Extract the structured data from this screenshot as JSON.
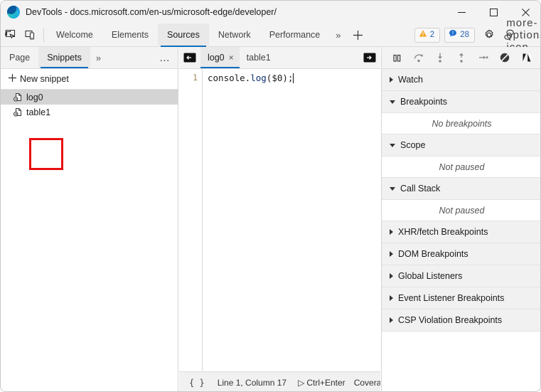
{
  "window": {
    "title": "DevTools - docs.microsoft.com/en-us/microsoft-edge/developer/",
    "controls": {
      "minimize": "minimize-button",
      "maximize": "maximize-button",
      "close": "close-button"
    }
  },
  "toolbar": {
    "inspect_icon": "inspect-element-icon",
    "device_icon": "device-emulation-icon",
    "tabs": [
      {
        "label": "Welcome",
        "active": false
      },
      {
        "label": "Elements",
        "active": false
      },
      {
        "label": "Sources",
        "active": true
      },
      {
        "label": "Network",
        "active": false
      },
      {
        "label": "Performance",
        "active": false
      }
    ],
    "more_tabs": "»",
    "add_tab": "+",
    "warnings": {
      "icon": "warning-triangle-icon",
      "count": "2"
    },
    "issues": {
      "icon": "message-bubble-icon",
      "count": "28"
    },
    "settings_icon": "gear-icon",
    "feedback_icon": "feedback-icon",
    "more_icon": "more-options-icon"
  },
  "navigator": {
    "tabs": [
      {
        "label": "Page",
        "active": false
      },
      {
        "label": "Snippets",
        "active": true
      }
    ],
    "more_tabs": "»",
    "more_options": "…",
    "new_snippet": {
      "plus": "+",
      "label": "New snippet"
    },
    "snippets": [
      {
        "label": "log0",
        "selected": true
      },
      {
        "label": "table1",
        "selected": false
      }
    ],
    "highlight_color": "#e8100f"
  },
  "editor": {
    "scroll_left_icon": "panel-collapse-left-icon",
    "scroll_right_icon": "panel-expand-right-icon",
    "tabs": [
      {
        "label": "log0",
        "active": true,
        "close": "×"
      },
      {
        "label": "table1",
        "active": false
      }
    ],
    "line_number": "1",
    "code_before": "console.",
    "code_method": "log",
    "code_after": "($0);",
    "status": {
      "format_icon": "{ }",
      "position": "Line 1, Column 17",
      "run_icon": "▷",
      "run_label": "Ctrl+Enter",
      "coverage": "Coverag"
    }
  },
  "debugger": {
    "controls": [
      {
        "name": "pause-script-icon"
      },
      {
        "name": "step-over-icon"
      },
      {
        "name": "step-into-icon"
      },
      {
        "name": "step-out-icon"
      },
      {
        "name": "step-icon"
      },
      {
        "name": "deactivate-breakpoints-icon"
      },
      {
        "name": "pause-on-exceptions-icon"
      }
    ],
    "sections": [
      {
        "label": "Watch",
        "expanded": false,
        "empty": null
      },
      {
        "label": "Breakpoints",
        "expanded": true,
        "empty": "No breakpoints"
      },
      {
        "label": "Scope",
        "expanded": true,
        "empty": "Not paused"
      },
      {
        "label": "Call Stack",
        "expanded": true,
        "empty": "Not paused"
      },
      {
        "label": "XHR/fetch Breakpoints",
        "expanded": false,
        "empty": null
      },
      {
        "label": "DOM Breakpoints",
        "expanded": false,
        "empty": null
      },
      {
        "label": "Global Listeners",
        "expanded": false,
        "empty": null
      },
      {
        "label": "Event Listener Breakpoints",
        "expanded": false,
        "empty": null
      },
      {
        "label": "CSP Violation Breakpoints",
        "expanded": false,
        "empty": null
      }
    ]
  }
}
